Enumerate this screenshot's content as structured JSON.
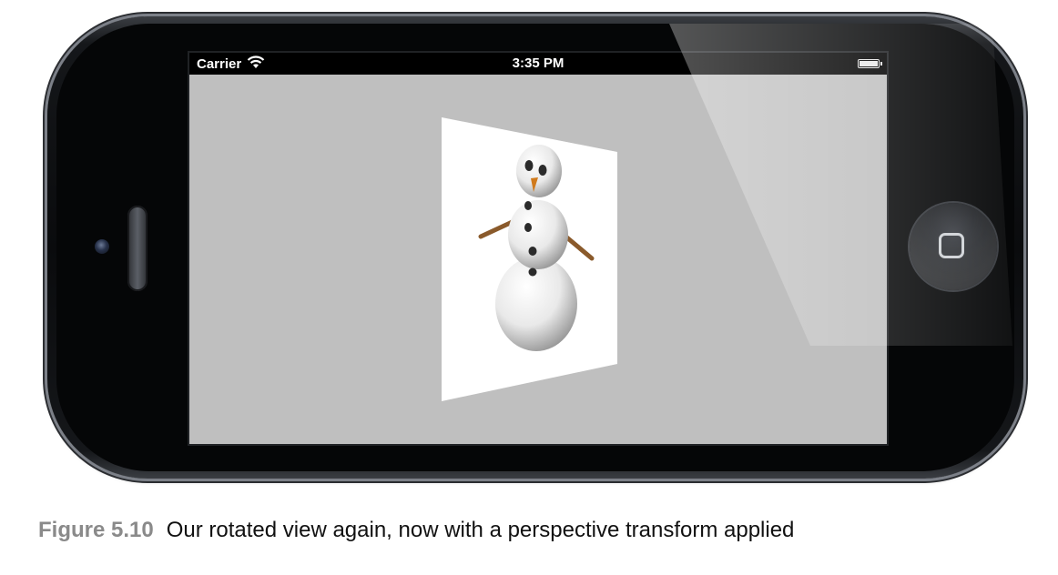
{
  "status_bar": {
    "carrier": "Carrier",
    "time": "3:35 PM"
  },
  "icons": {
    "wifi": "wifi-icon",
    "battery": "battery-icon",
    "home": "home-button-icon"
  },
  "colors": {
    "screen_background": "#bfbfbf",
    "status_bar": "#000000",
    "caption_label": "#8a8a8a"
  },
  "caption": {
    "label": "Figure 5.10",
    "text": "Our rotated view again, now with a perspective transform applied"
  }
}
